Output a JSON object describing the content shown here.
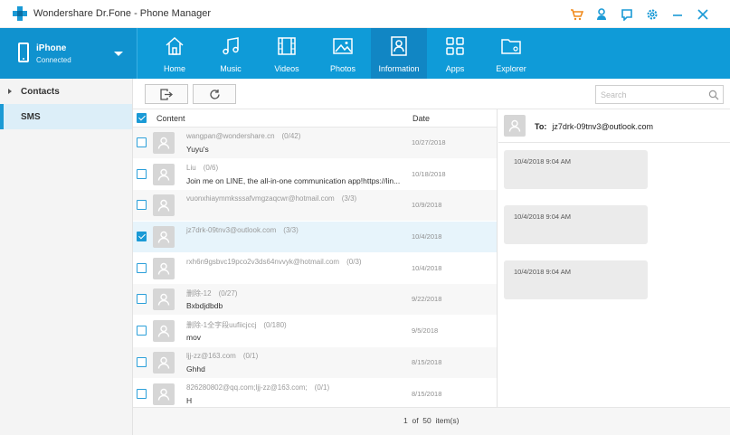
{
  "app": {
    "title": "Wondershare Dr.Fone - Phone Manager",
    "brand_color": "#0f9bd8",
    "window_icons": [
      "cart-icon",
      "user-icon",
      "feedback-icon",
      "settings-icon",
      "minimize-icon",
      "close-icon"
    ]
  },
  "device": {
    "name": "iPhone",
    "status": "Connected"
  },
  "tabs": [
    {
      "label": "Home",
      "icon": "home-icon"
    },
    {
      "label": "Music",
      "icon": "music-icon"
    },
    {
      "label": "Videos",
      "icon": "videos-icon"
    },
    {
      "label": "Photos",
      "icon": "photos-icon"
    },
    {
      "label": "Information",
      "icon": "contact-card-icon",
      "active": true
    },
    {
      "label": "Apps",
      "icon": "apps-icon"
    },
    {
      "label": "Explorer",
      "icon": "folder-icon"
    }
  ],
  "sidebar": {
    "items": [
      {
        "label": "Contacts",
        "expandable": true
      },
      {
        "label": "SMS",
        "selected": true
      }
    ]
  },
  "toolbar": {
    "buttons": [
      "export-icon",
      "refresh-icon"
    ],
    "search_placeholder": "Search"
  },
  "list": {
    "header": {
      "content": "Content",
      "date": "Date"
    },
    "header_checked": true,
    "rows": [
      {
        "from": "wangpan@wondershare.cn",
        "count": "(0/42)",
        "preview": "Yuyu's",
        "date": "10/27/2018",
        "checked": false
      },
      {
        "from": "Liu",
        "count": "(0/6)",
        "preview": "Join me on LINE, the all-in-one communication app!https://lin...",
        "date": "10/18/2018",
        "checked": false
      },
      {
        "from": "vuonxhiaymmksssafvmgzaqcwr@hotmail.com",
        "count": "(3/3)",
        "preview": "",
        "date": "10/9/2018",
        "checked": false
      },
      {
        "from": "jz7drk-09tnv3@outlook.com",
        "count": "(3/3)",
        "preview": "",
        "date": "10/4/2018",
        "checked": true
      },
      {
        "from": "rxh6n9gsbvc19pco2v3ds64nvvyk@hotmail.com",
        "count": "(0/3)",
        "preview": "",
        "date": "10/4/2018",
        "checked": false
      },
      {
        "from": "删除-12",
        "count": "(0/27)",
        "preview": "Bxbdjdbdb",
        "date": "9/22/2018",
        "checked": false
      },
      {
        "from": "删除-1全字段uufiicjccj",
        "count": "(0/180)",
        "preview": "mov",
        "date": "9/5/2018",
        "checked": false
      },
      {
        "from": "ljj-zz@163.com",
        "count": "(0/1)",
        "preview": "Ghhd",
        "date": "8/15/2018",
        "checked": false
      },
      {
        "from": "826280802@qq.com;ljj-zz@163.com;",
        "count": "(0/1)",
        "preview": "H",
        "date": "8/15/2018",
        "checked": false
      }
    ]
  },
  "footer": {
    "current_page": "1",
    "of": "of",
    "total": "50",
    "unit": "item(s)"
  },
  "conversation": {
    "to_label": "To:",
    "to_address": "jz7drk-09tnv3@outlook.com",
    "messages": [
      {
        "timestamp": "10/4/2018 9:04 AM"
      },
      {
        "timestamp": "10/4/2018 9:04 AM"
      },
      {
        "timestamp": "10/4/2018 9:04 AM"
      }
    ]
  }
}
